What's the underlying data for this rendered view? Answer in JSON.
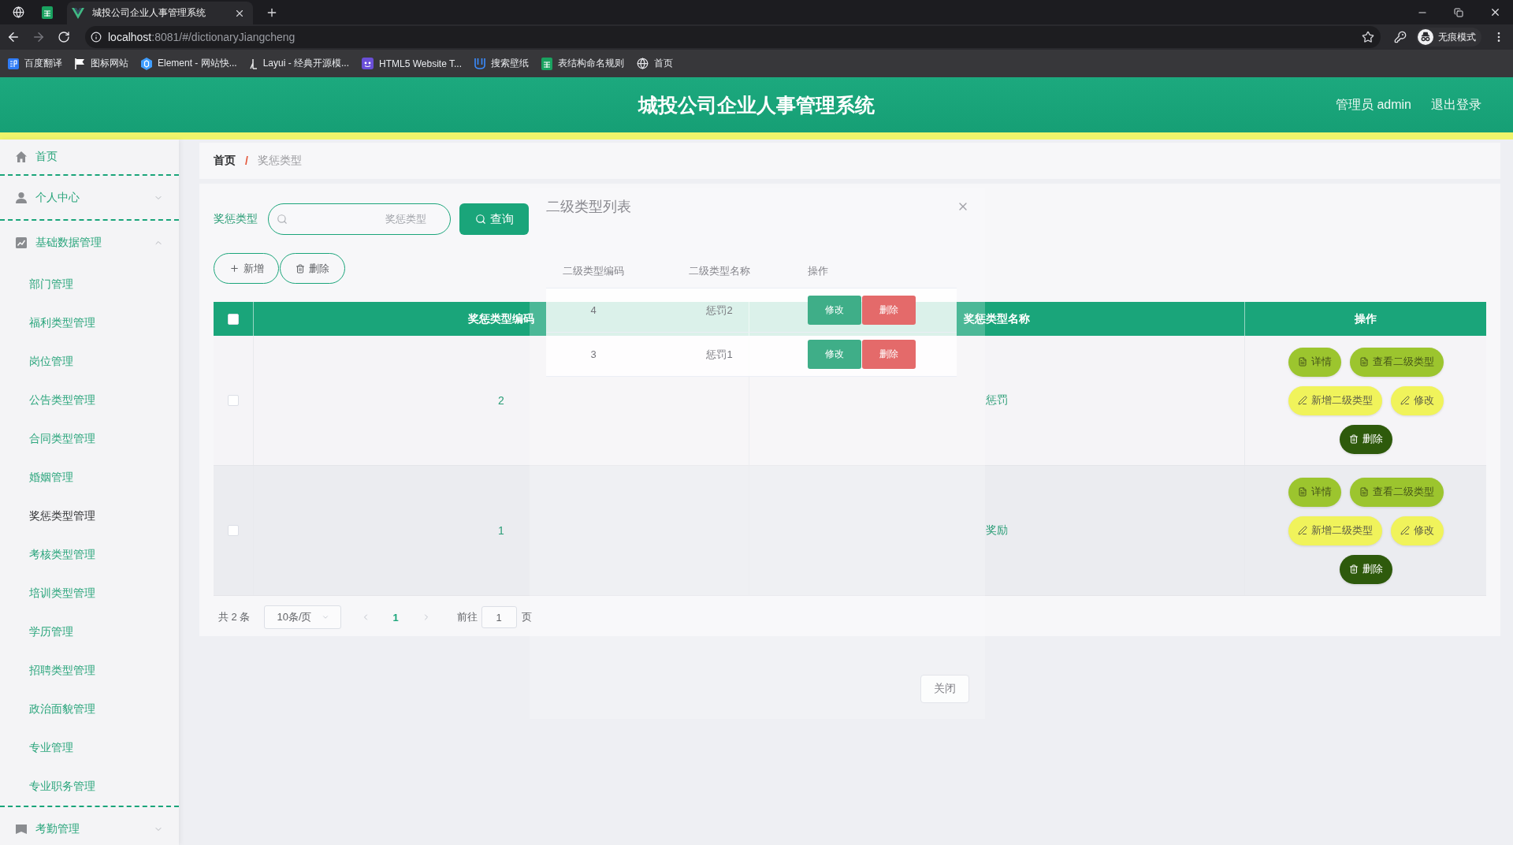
{
  "browser": {
    "tabs": [
      {
        "kind": "pinned",
        "selected": false
      },
      {
        "kind": "pinned",
        "selected": false
      },
      {
        "kind": "page",
        "title": "城投公司企业人事管理系统",
        "selected": true
      }
    ],
    "forward_disabled": true,
    "url_host": "localhost",
    "url_rest": ":8081/#/dictionaryJiangcheng",
    "profile": "无痕模式",
    "bookmarks": [
      "百度翻译",
      "图标网站",
      "Element - 网站快...",
      "Layui - 经典开源模...",
      "HTML5 Website T...",
      "搜索壁纸",
      "表结构命名规则",
      "首页"
    ]
  },
  "header": {
    "title": "城投公司企业人事管理系统",
    "user": "管理员 admin",
    "logout": "退出登录"
  },
  "sidebar": {
    "items": [
      {
        "kind": "link",
        "label": "首页",
        "selected": false
      },
      {
        "kind": "menu",
        "label": "个人中心",
        "expanded": false
      },
      {
        "kind": "menu",
        "label": "基础数据管理",
        "expanded": true,
        "children": [
          {
            "label": "部门管理",
            "selected": false
          },
          {
            "label": "福利类型管理",
            "selected": false
          },
          {
            "label": "岗位管理",
            "selected": false
          },
          {
            "label": "公告类型管理",
            "selected": false
          },
          {
            "label": "合同类型管理",
            "selected": false
          },
          {
            "label": "婚姻管理",
            "selected": false
          },
          {
            "label": "奖惩类型管理",
            "selected": true
          },
          {
            "label": "考核类型管理",
            "selected": false
          },
          {
            "label": "培训类型管理",
            "selected": false
          },
          {
            "label": "学历管理",
            "selected": false
          },
          {
            "label": "招聘类型管理",
            "selected": false
          },
          {
            "label": "政治面貌管理",
            "selected": false
          },
          {
            "label": "专业管理",
            "selected": false
          },
          {
            "label": "专业职务管理",
            "selected": false
          }
        ]
      },
      {
        "kind": "menu",
        "label": "考勤管理",
        "expanded": false
      }
    ]
  },
  "breadcrumb": {
    "items": [
      "首页",
      "奖惩类型"
    ],
    "separator": "/"
  },
  "search": {
    "label": "奖惩类型",
    "placeholder": "奖惩类型",
    "button": "查询"
  },
  "toolbar": [
    {
      "kind": "add",
      "label": "新增"
    },
    {
      "kind": "delete",
      "label": "删除"
    }
  ],
  "table": {
    "all_checked": false,
    "columns": [
      "奖惩类型编码",
      "奖惩类型名称",
      "操作"
    ],
    "rows": [
      {
        "checked": false,
        "code": "2",
        "name": "惩罚",
        "buttons": [
          {
            "kind": "detail",
            "label": "详情"
          },
          {
            "kind": "view",
            "label": "查看二级类型"
          },
          {
            "kind": "add",
            "label": "新增二级类型"
          },
          {
            "kind": "edit",
            "label": "修改"
          },
          {
            "kind": "delete",
            "label": "删除"
          }
        ]
      },
      {
        "checked": false,
        "code": "1",
        "name": "奖励",
        "buttons": [
          {
            "kind": "detail",
            "label": "详情"
          },
          {
            "kind": "view",
            "label": "查看二级类型"
          },
          {
            "kind": "add",
            "label": "新增二级类型"
          },
          {
            "kind": "edit",
            "label": "修改"
          },
          {
            "kind": "delete",
            "label": "删除"
          }
        ]
      }
    ]
  },
  "pagination": {
    "total": "共 2 条",
    "page_size": "10条/页",
    "prev_disabled": true,
    "next_disabled": true,
    "pages": [
      {
        "label": "1",
        "selected": true
      }
    ],
    "goto": "前往",
    "page_input": "1",
    "page_unit": "页"
  },
  "dialog": {
    "title": "二级类型列表",
    "columns": [
      "二级类型编码",
      "二级类型名称",
      "操作"
    ],
    "rows": [
      {
        "code": "4",
        "name": "惩罚2",
        "buttons": [
          {
            "kind": "edit",
            "label": "修改"
          },
          {
            "kind": "delete",
            "label": "删除"
          }
        ]
      },
      {
        "code": "3",
        "name": "惩罚1",
        "buttons": [
          {
            "kind": "edit",
            "label": "修改"
          },
          {
            "kind": "delete",
            "label": "删除"
          }
        ]
      }
    ],
    "close": "关闭"
  }
}
